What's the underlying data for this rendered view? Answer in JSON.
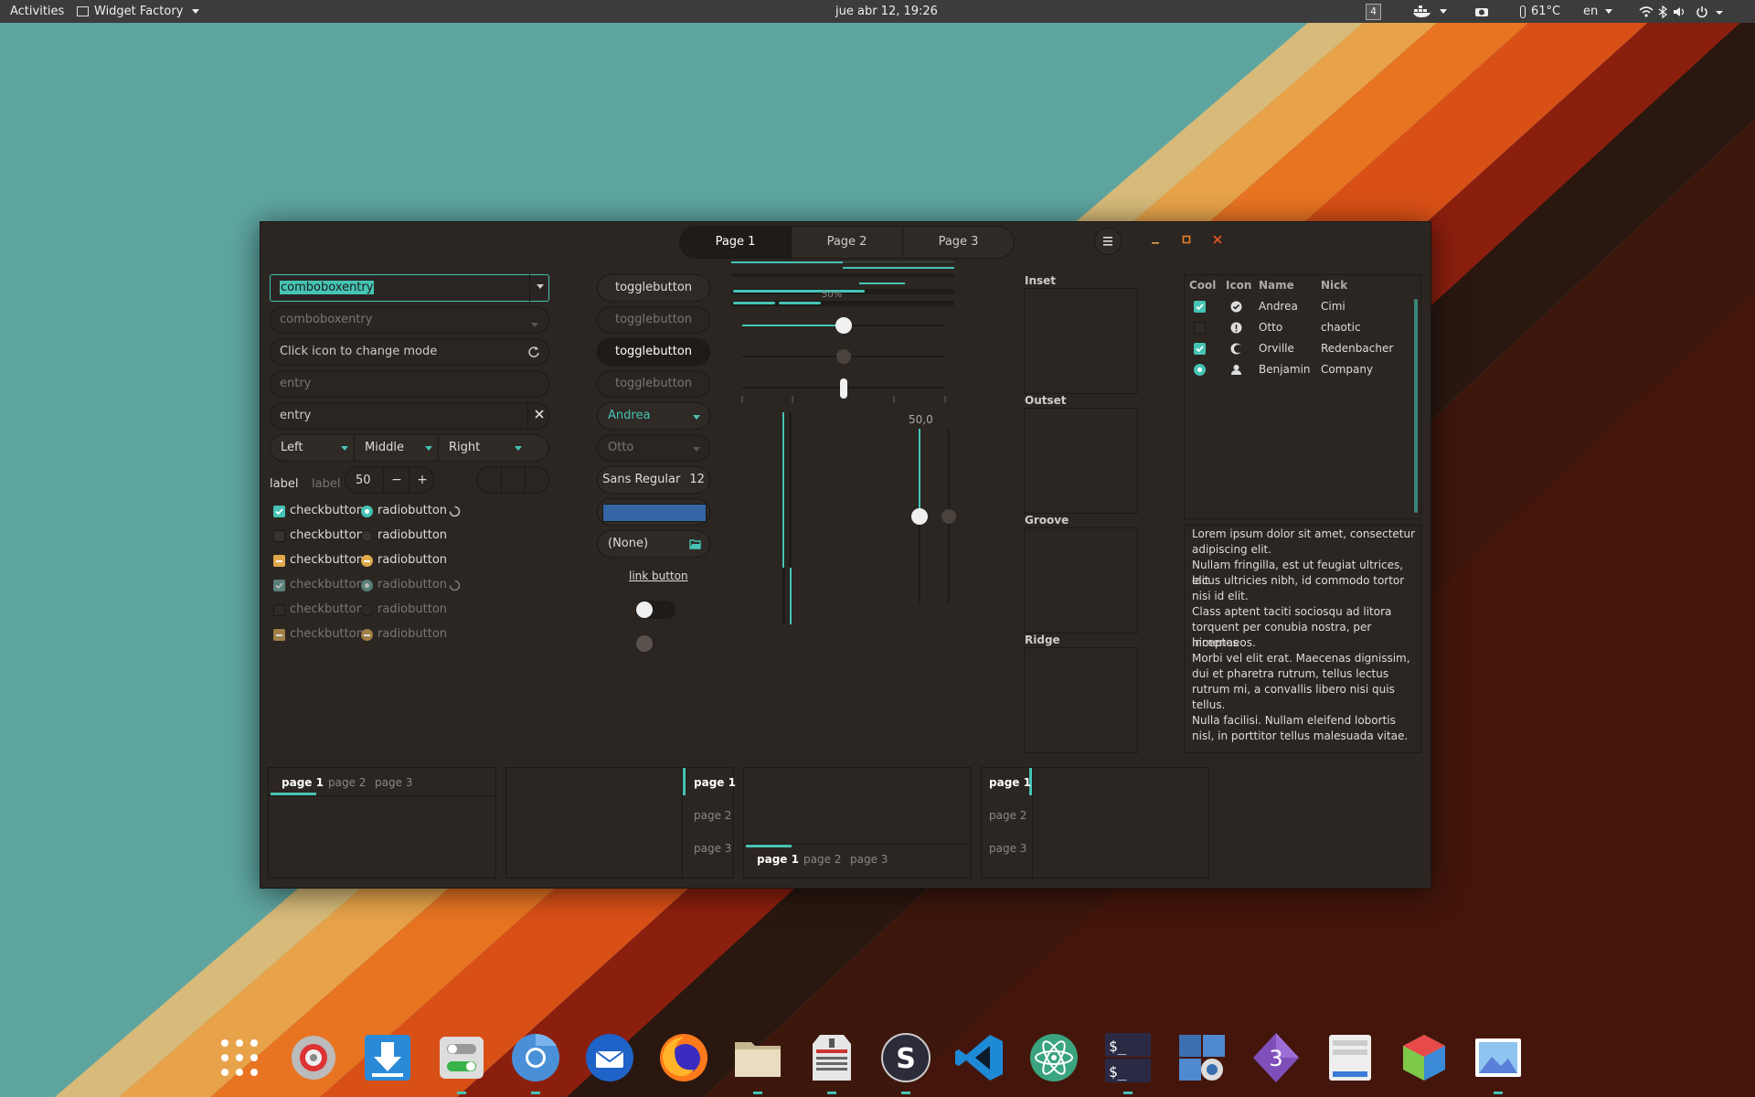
{
  "topbar": {
    "activities": "Activities",
    "app_name": "Widget Factory",
    "clock": "jue abr 12, 19:26",
    "workspace": "4",
    "temperature": "61°C",
    "keyboard": "en"
  },
  "window": {
    "tabs": [
      "Page 1",
      "Page 2",
      "Page 3"
    ],
    "active_tab": 0,
    "left_column": {
      "combo1": "comboboxentry",
      "combo2": "comboboxentry",
      "entry_mode": "Click icon to change mode",
      "entry_placeholder": "entry",
      "entry_value": "entry",
      "combo_left": "Left",
      "combo_middle": "Middle",
      "combo_right": "Right",
      "label1": "label",
      "label2": "label",
      "spin_value": "50",
      "spin_minus": "−",
      "spin_plus": "+",
      "checkbuttons": [
        "checkbutton",
        "checkbutton",
        "checkbutton",
        "checkbutton",
        "checkbutton",
        "checkbutton"
      ],
      "radiobuttons": [
        "radiobutton",
        "radiobutton",
        "radiobutton",
        "radiobutton",
        "radiobutton",
        "radiobutton"
      ]
    },
    "middle_column": {
      "toggle1": "togglebutton",
      "toggle2": "togglebutton",
      "toggle3": "togglebutton",
      "toggle4": "togglebutton",
      "combo_andrea": "Andrea",
      "combo_otto": "Otto",
      "font_name": "Sans Regular",
      "font_size": "12",
      "color_hex": "#3465a4",
      "file_chooser": "(None)",
      "link": "link button",
      "switch1_on": false,
      "switch2_on": false
    },
    "scales": {
      "progress_label": "50%",
      "progress_value": 0.5,
      "hscale1_value": 0.5,
      "vscale_label": "50,0",
      "vscale_value": 0.5
    },
    "frames": [
      "Inset",
      "Outset",
      "Groove",
      "Ridge"
    ],
    "tree": {
      "columns": [
        "Cool",
        "Icon",
        "Name",
        "Nick"
      ],
      "rows": [
        {
          "cool": true,
          "name": "Andrea",
          "nick": "Cimi",
          "icon": "check-circle-icon"
        },
        {
          "cool": false,
          "name": "Otto",
          "nick": "chaotic",
          "icon": "alert-icon"
        },
        {
          "cool": true,
          "name": "Orville",
          "nick": "Redenbacher",
          "icon": "moon-icon"
        },
        {
          "cool": "radio",
          "name": "Benjamin",
          "nick": "Company",
          "icon": "person-icon"
        }
      ]
    },
    "textview": [
      "Lorem ipsum dolor sit amet, consectetur",
      "adipiscing elit.",
      "Nullam fringilla, est ut feugiat ultrices, elit",
      "lacus ultricies nibh, id commodo tortor",
      "nisi id elit.",
      "Class aptent taciti sociosqu ad litora",
      "torquent per conubia nostra, per inceptos",
      "himenaeos.",
      "Morbi vel elit erat. Maecenas dignissim,",
      "dui et pharetra rutrum, tellus lectus",
      "rutrum mi, a convallis libero nisi quis",
      "tellus.",
      "Nulla facilisi. Nullam eleifend lobortis",
      "nisl, in porttitor tellus malesuada vitae."
    ],
    "notebooks": [
      {
        "tabs": [
          "page 1",
          "page 2",
          "page 3"
        ],
        "position": "top"
      },
      {
        "tabs": [
          "page 1",
          "page 2",
          "page 3"
        ],
        "position": "right"
      },
      {
        "tabs": [
          "page 1",
          "page 2",
          "page 3"
        ],
        "position": "bottom"
      },
      {
        "tabs": [
          "page 1",
          "page 2",
          "page 3"
        ],
        "position": "left"
      }
    ]
  },
  "colors": {
    "accent": "#46c3b5",
    "warning": "#e0a84a",
    "window_bg": "#2b2622"
  },
  "dock": [
    "apps-grid-icon",
    "settings-icon",
    "downloader-icon",
    "tweaks-icon",
    "chromium-icon",
    "thunderbird-icon",
    "firefox-icon",
    "files-icon",
    "archive-icon",
    "steam-icon",
    "vscode-icon",
    "atom-icon",
    "terminal-icon",
    "screenshot-icon",
    "gambas-icon",
    "glade-icon",
    "cube-icon",
    "image-viewer-icon"
  ]
}
